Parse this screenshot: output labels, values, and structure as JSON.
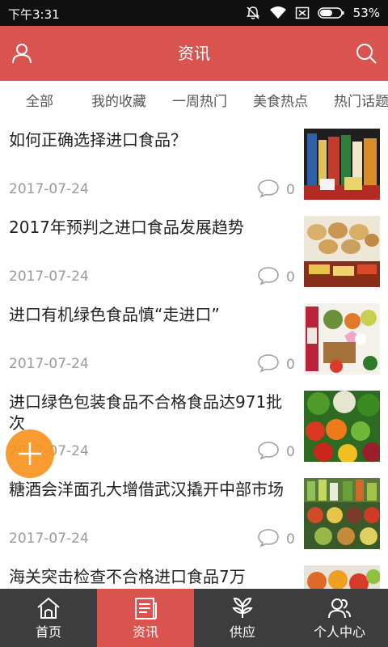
{
  "status_bar": {
    "time": "下午3:31",
    "battery": "53%",
    "icons": [
      "mute-icon",
      "wifi-icon",
      "sim-icon",
      "battery-icon"
    ]
  },
  "header": {
    "title": "资讯",
    "left_icon": "user-icon",
    "right_icon": "search-icon",
    "background": "#d9534f"
  },
  "tabs": [
    {
      "label": "全部"
    },
    {
      "label": "我的收藏"
    },
    {
      "label": "一周热门"
    },
    {
      "label": "美食热点"
    },
    {
      "label": "热门话题"
    }
  ],
  "news": [
    {
      "title": "如何正确选择进口食品？",
      "date": "2017-07-24",
      "comments": "0"
    },
    {
      "title": "2017年预判之进口食品发展趋势",
      "date": "2017-07-24",
      "comments": "0"
    },
    {
      "title": "进口有机绿色食品慎“走进口”",
      "date": "2017-07-24",
      "comments": "0"
    },
    {
      "title": "进口绿色包装食品不合格食品达971批次",
      "date": "2017-07-24",
      "comments": "0"
    },
    {
      "title": "糖酒会洋面孔大增借武汉撬开中部市场",
      "date": "2017-07-24",
      "comments": "0"
    },
    {
      "title": "海关突击检查不合格进口食品7万",
      "date": "",
      "comments": ""
    }
  ],
  "fab": {
    "icon": "plus-icon",
    "color": "#f7931e"
  },
  "bottom_nav": [
    {
      "label": "首页",
      "icon": "home-icon"
    },
    {
      "label": "资讯",
      "icon": "news-icon",
      "active": true
    },
    {
      "label": "供应",
      "icon": "leaf-icon"
    },
    {
      "label": "个人中心",
      "icon": "profile-icon"
    }
  ]
}
